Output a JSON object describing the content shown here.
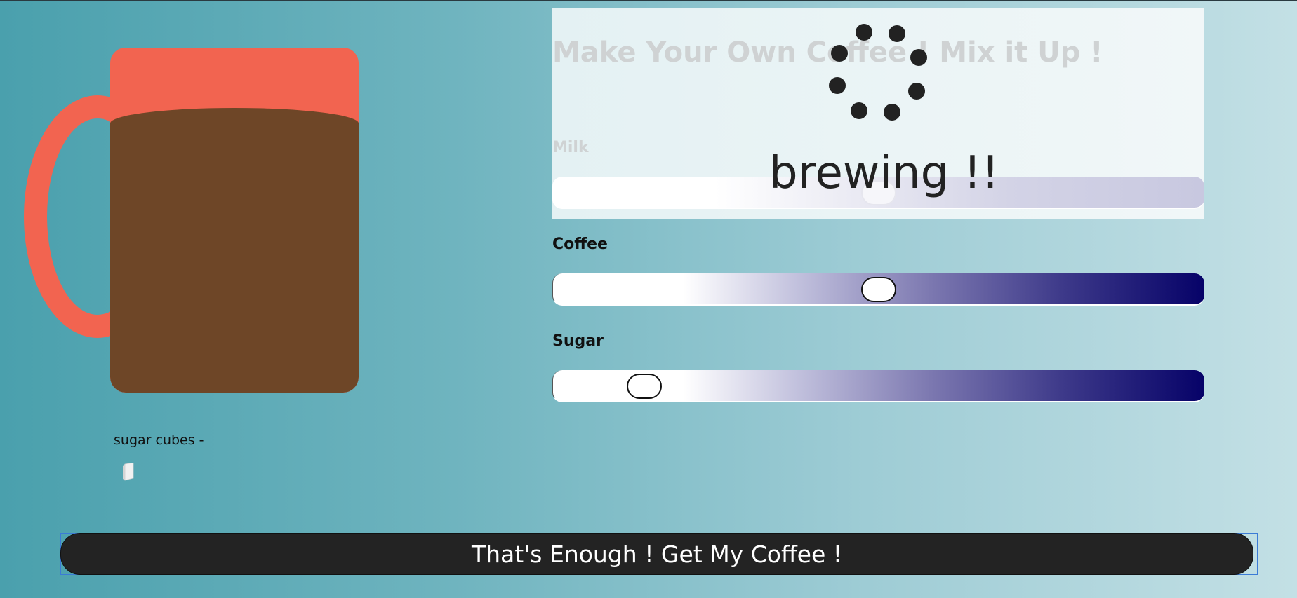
{
  "title": "Make Your Own Coffee ! Mix it Up !",
  "sliders": {
    "milk": {
      "label": "Milk",
      "value": 0.5
    },
    "coffee": {
      "label": "Coffee",
      "value": 0.5
    },
    "sugar": {
      "label": "Sugar",
      "value": 0.12
    }
  },
  "overlay": {
    "status_text": "brewing !!"
  },
  "cup": {
    "sugar_label": "sugar cubes -",
    "sugar_cube_icon": "sugar-cube",
    "mug_color": "#f26450",
    "coffee_color": "#6e4627"
  },
  "cta": {
    "label": "That's Enough ! Get My Coffee !"
  },
  "colors": {
    "slider_high": "#060268",
    "button_bg": "#232323"
  }
}
